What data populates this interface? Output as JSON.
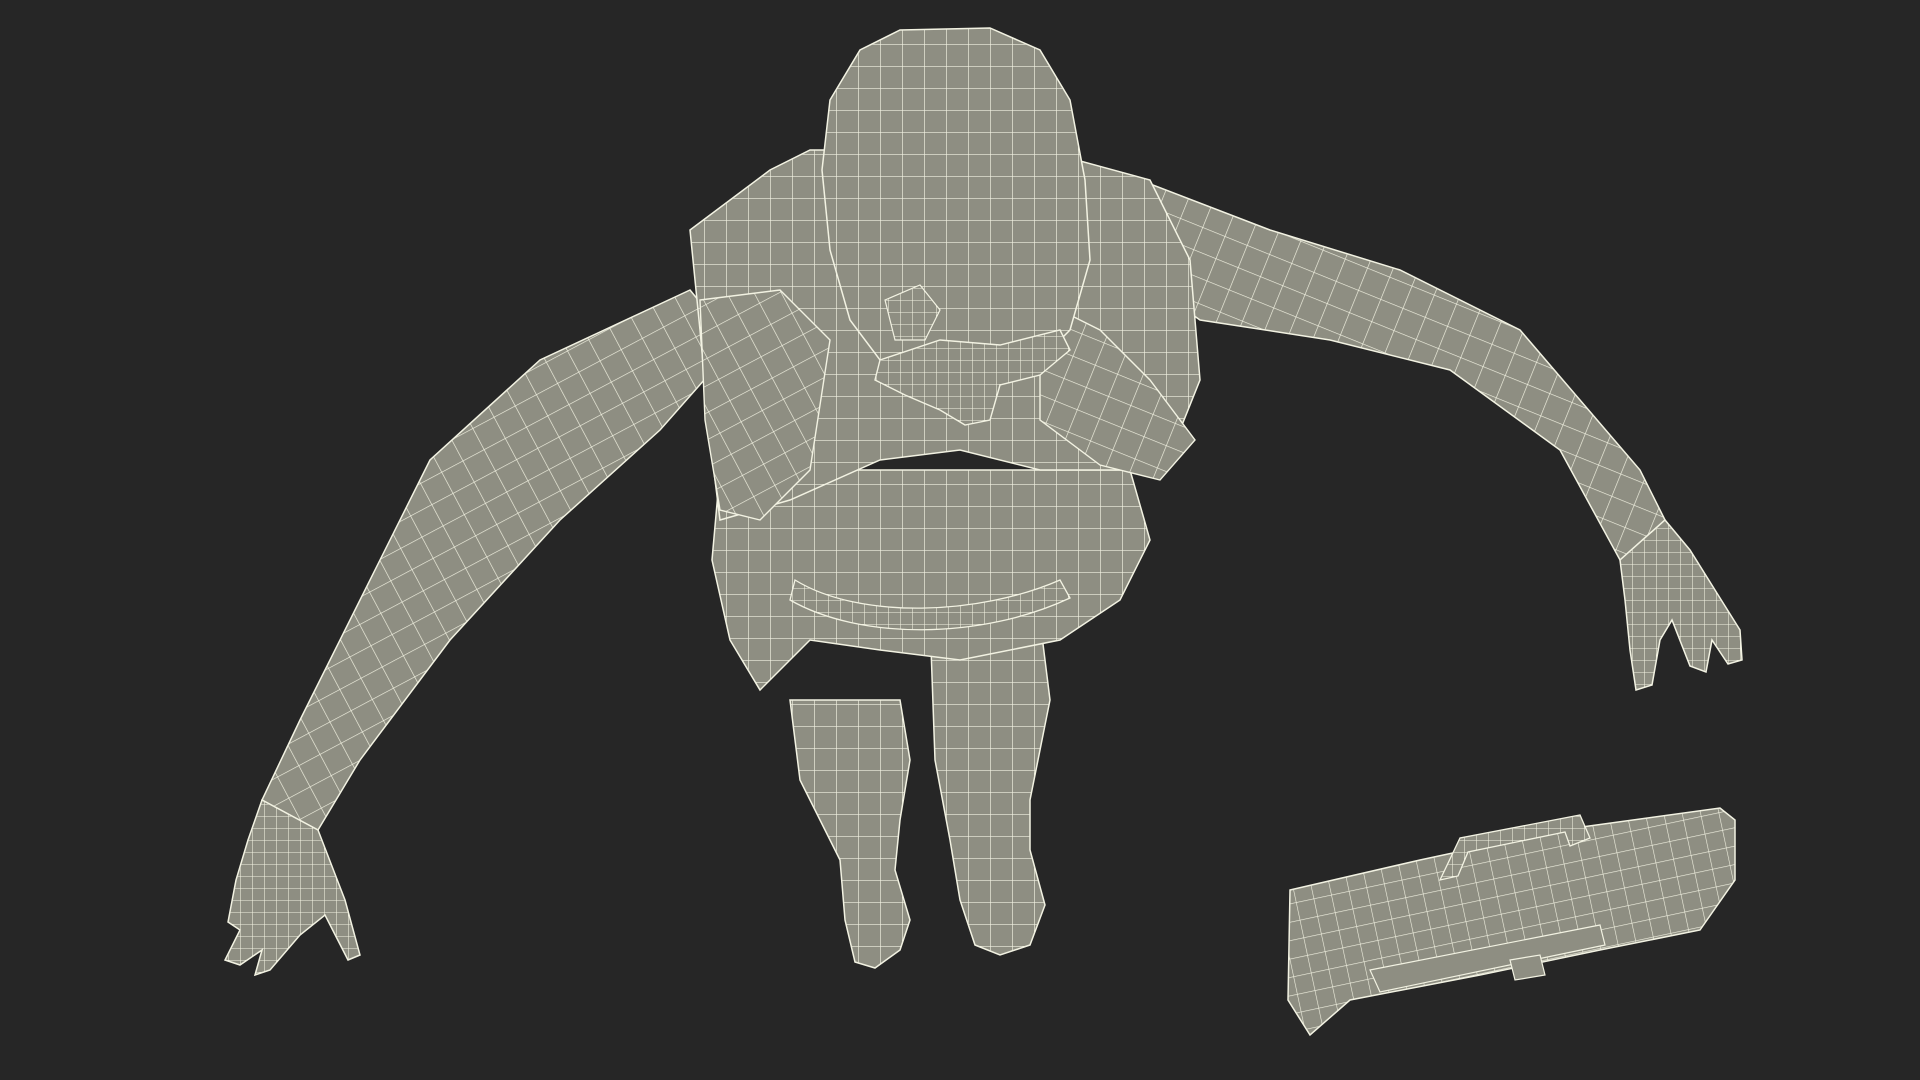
{
  "scene": {
    "background_color": "#262626",
    "mesh_fill_color": "#8e8e82",
    "wireframe_color": "#f2f2e2",
    "subject": "wireframe-3d-model-female-figure-top-view",
    "objects": [
      "figure",
      "briefcase"
    ]
  }
}
